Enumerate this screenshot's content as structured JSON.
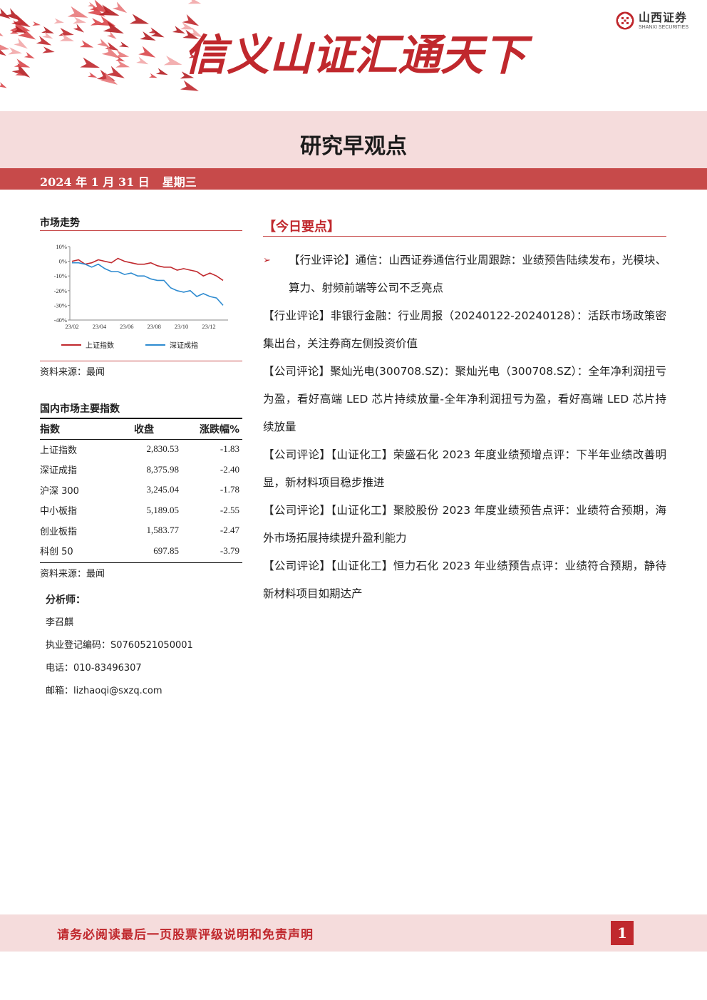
{
  "header": {
    "slogan": "信义山证汇通天下",
    "logo_cn": "山西证券",
    "logo_en": "SHANXI SECURITIES",
    "title": "研究早观点",
    "date": "2024 年 1 月 31 日",
    "weekday": "星期三"
  },
  "market_trend": {
    "title": "市场走势",
    "source": "资料来源：最闻"
  },
  "chart_data": {
    "type": "line",
    "x": [
      "23/02",
      "23/04",
      "23/06",
      "23/08",
      "23/10",
      "23/12"
    ],
    "ylim": [
      -40,
      10
    ],
    "yticks": [
      "10%",
      "0%",
      "-10%",
      "-20%",
      "-30%",
      "-40%"
    ],
    "series": [
      {
        "name": "上证指数",
        "color": "#c0282d",
        "values": [
          0,
          1,
          -2,
          -1,
          1,
          0,
          -1,
          2,
          0,
          -1,
          -2,
          -2,
          -1,
          -3,
          -4,
          -4,
          -6,
          -5,
          -6,
          -7,
          -10,
          -8,
          -10,
          -13
        ]
      },
      {
        "name": "深证成指",
        "color": "#2e8bd0",
        "values": [
          -1,
          -1,
          -2,
          -4,
          -2,
          -5,
          -7,
          -7,
          -9,
          -8,
          -10,
          -10,
          -12,
          -13,
          -13,
          -18,
          -20,
          -21,
          -20,
          -24,
          -22,
          -24,
          -25,
          -30
        ]
      }
    ]
  },
  "index_table": {
    "title": "国内市场主要指数",
    "headers": [
      "指数",
      "收盘",
      "涨跌幅%"
    ],
    "rows": [
      [
        "上证指数",
        "2,830.53",
        "-1.83"
      ],
      [
        "深证成指",
        "8,375.98",
        "-2.40"
      ],
      [
        "沪深 300",
        "3,245.04",
        "-1.78"
      ],
      [
        "中小板指",
        "5,189.05",
        "-2.55"
      ],
      [
        "创业板指",
        "1,583.77",
        "-2.47"
      ],
      [
        "科创 50",
        "697.85",
        "-3.79"
      ]
    ],
    "source": "资料来源：最闻"
  },
  "analyst": {
    "label": "分析师：",
    "name": "李召麒",
    "license": "执业登记编码：S0760521050001",
    "phone": "电话：010-83496307",
    "email": "邮箱：lizhaoqi@sxzq.com"
  },
  "key_points": {
    "title": "【今日要点】",
    "items": [
      "【行业评论】通信：山西证券通信行业周跟踪：业绩预告陆续发布，光模块、算力、射频前端等公司不乏亮点",
      "【行业评论】非银行金融：行业周报（20240122-20240128）：活跃市场政策密集出台，关注券商左侧投资价值",
      "【公司评论】聚灿光电(300708.SZ)：聚灿光电（300708.SZ）：全年净利润扭亏为盈，看好高端 LED 芯片持续放量-全年净利润扭亏为盈，看好高端 LED 芯片持续放量",
      "【公司评论】【山证化工】荣盛石化 2023 年度业绩预增点评：下半年业绩改善明显，新材料项目稳步推进",
      "【公司评论】【山证化工】聚胶股份 2023 年度业绩预告点评：业绩符合预期，海外市场拓展持续提升盈利能力",
      "【公司评论】【山证化工】恒力石化 2023 年业绩预告点评：业绩符合预期，静待新材料项目如期达产"
    ]
  },
  "footer": {
    "disclaimer": "请务必阅读最后一页股票评级说明和免责声明",
    "page": "1"
  }
}
